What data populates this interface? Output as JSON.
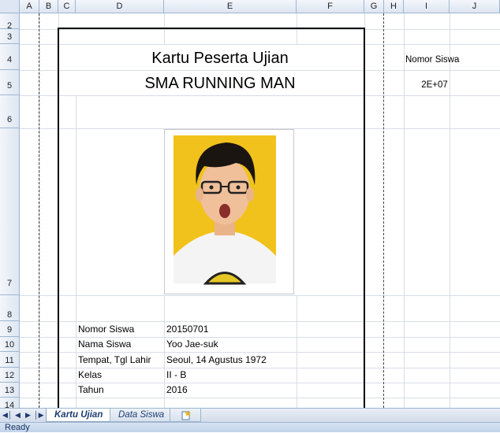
{
  "columns": [
    "A",
    "B",
    "C",
    "D",
    "E",
    "F",
    "G",
    "H",
    "I",
    "J"
  ],
  "rows": [
    "2",
    "3",
    "4",
    "5",
    "6",
    "7",
    "8",
    "9",
    "10",
    "11",
    "12",
    "13",
    "14"
  ],
  "card": {
    "title": "Kartu Peserta Ujian",
    "school": "SMA RUNNING MAN",
    "fields": [
      {
        "label": "Nomor Siswa",
        "value": "20150701"
      },
      {
        "label": "Nama Siswa",
        "value": "Yoo Jae-suk"
      },
      {
        "label": "Tempat, Tgl Lahir",
        "value": "Seoul, 14 Agustus 1972"
      },
      {
        "label": "Kelas",
        "value": "II - B"
      },
      {
        "label": "Tahun",
        "value": "2016"
      }
    ]
  },
  "lookup": {
    "label": "Nomor Siswa",
    "value": "2E+07"
  },
  "tabs": [
    "Kartu Ujian",
    "Data Siswa"
  ],
  "active_tab": "Kartu Ujian",
  "status": "Ready",
  "colors": {
    "header_bg": "#dde6f2",
    "header_border": "#9eb6ce",
    "gridline": "#d8dde6",
    "photo_bg": "#f1c21b"
  }
}
